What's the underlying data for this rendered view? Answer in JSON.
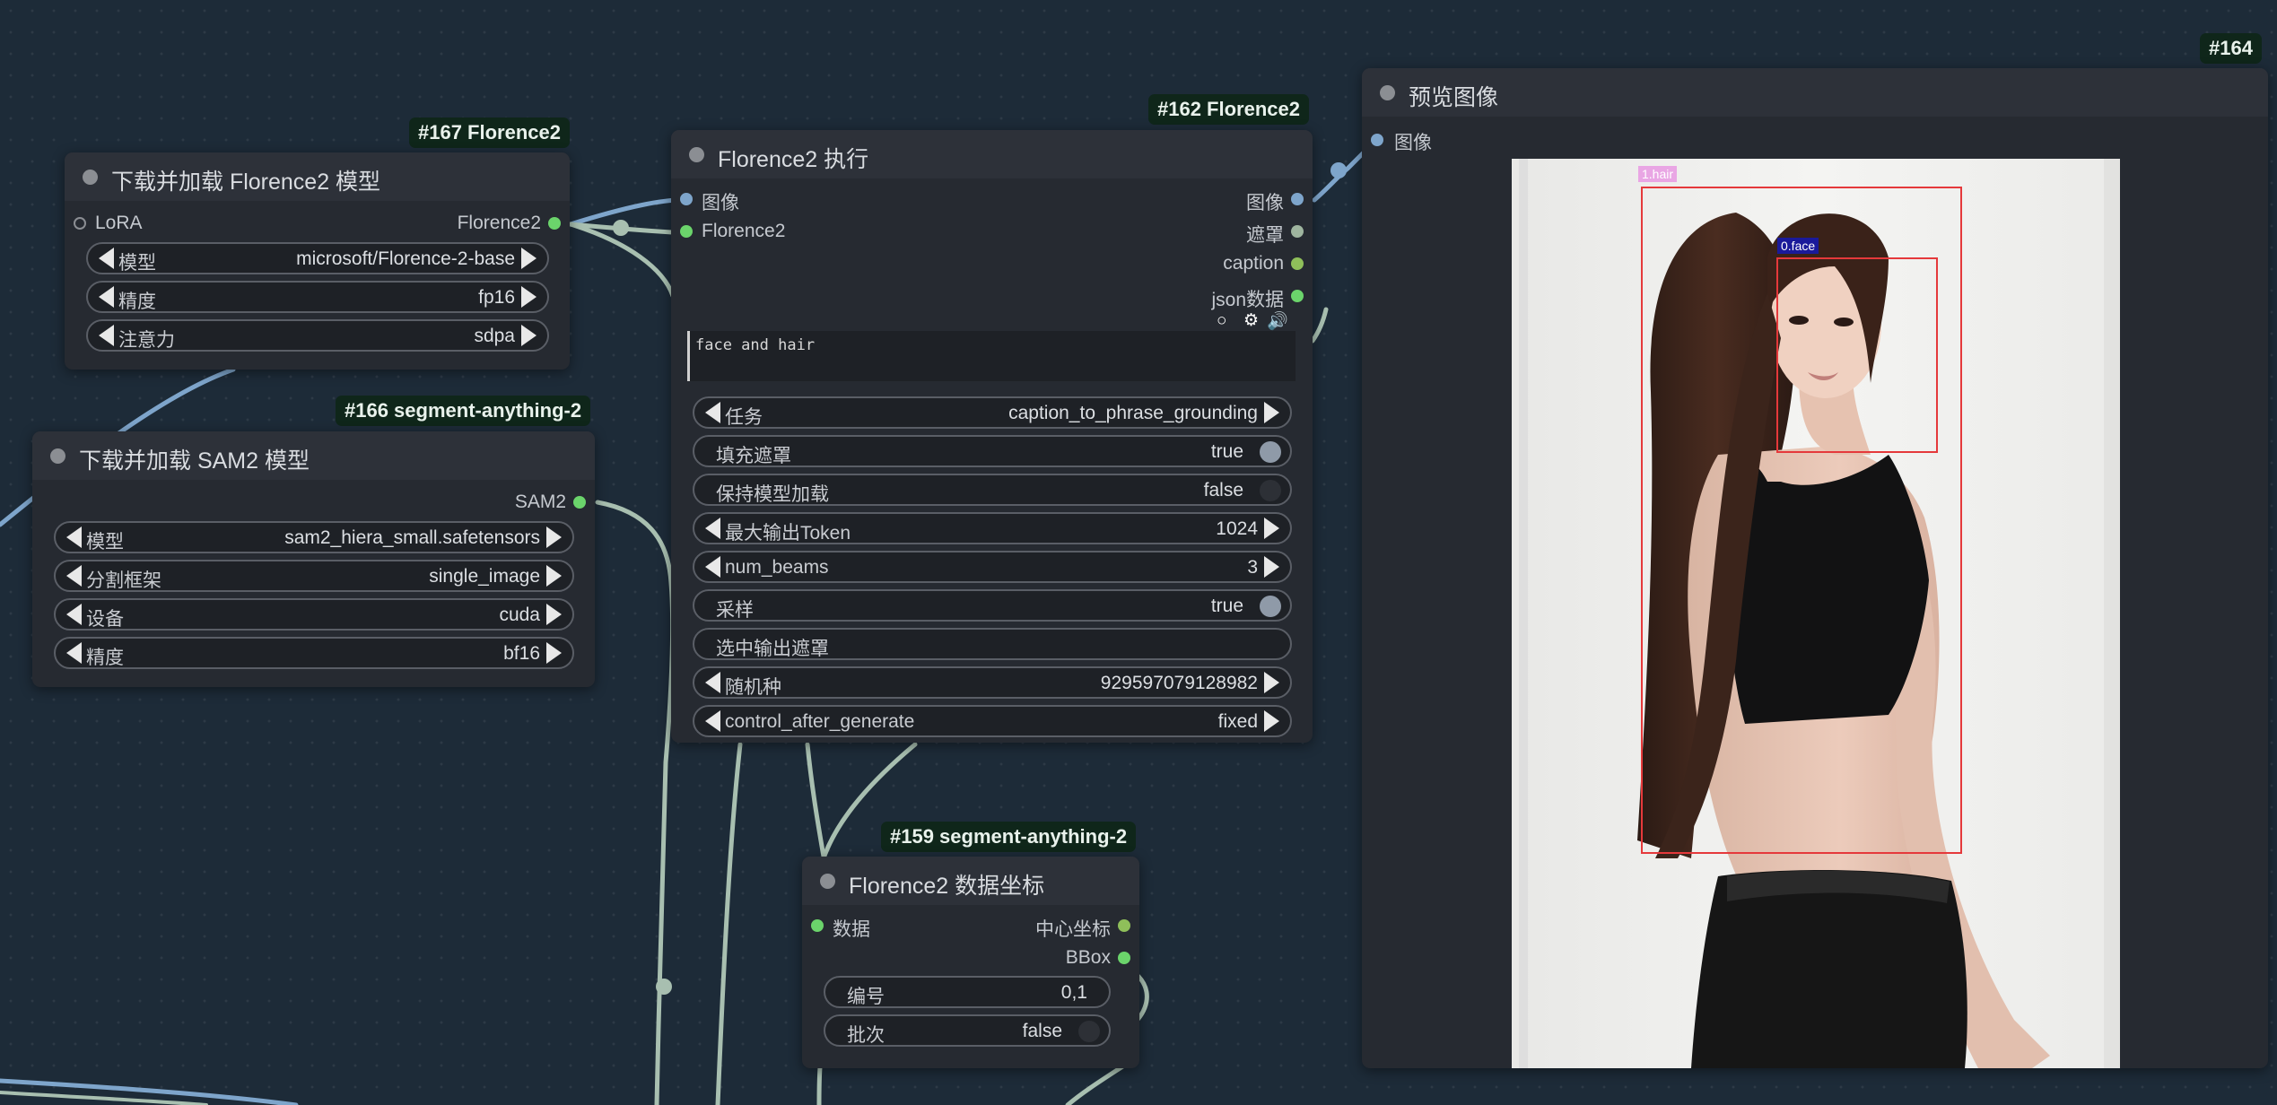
{
  "canvas": {
    "background": "#1d2b38",
    "wire_color": "#a8bfb0",
    "image_wire_color": "#7ea5cb"
  },
  "node_florence_loader": {
    "badge": "#167 Florence2",
    "title": "下载并加载 Florence2 模型",
    "input_lora": "LoRA",
    "output": "Florence2",
    "widgets": [
      {
        "label": "模型",
        "value": "microsoft/Florence-2-base"
      },
      {
        "label": "精度",
        "value": "fp16"
      },
      {
        "label": "注意力",
        "value": "sdpa"
      }
    ]
  },
  "node_sam2_loader": {
    "badge": "#166 segment-anything-2",
    "title": "下载并加载 SAM2 模型",
    "output": "SAM2",
    "widgets": [
      {
        "label": "模型",
        "value": "sam2_hiera_small.safetensors"
      },
      {
        "label": "分割框架",
        "value": "single_image"
      },
      {
        "label": "设备",
        "value": "cuda"
      },
      {
        "label": "精度",
        "value": "bf16"
      }
    ]
  },
  "node_florence_run": {
    "badge": "#162 Florence2",
    "title": "Florence2 执行",
    "inputs": [
      "图像",
      "Florence2"
    ],
    "outputs": [
      "图像",
      "遮罩",
      "caption",
      "json数据"
    ],
    "text_prompt": "face and hair",
    "widgets": {
      "task": {
        "label": "任务",
        "value": "caption_to_phrase_grounding"
      },
      "fill_mask": {
        "label": "填充遮罩",
        "value": "true"
      },
      "keep_loaded": {
        "label": "保持模型加载",
        "value": "false"
      },
      "max_tokens": {
        "label": "最大输出Token",
        "value": "1024"
      },
      "num_beams": {
        "label": "num_beams",
        "value": "3"
      },
      "do_sample": {
        "label": "采样",
        "value": "true"
      },
      "output_mask_select": {
        "label": "选中输出遮罩",
        "value": ""
      },
      "seed": {
        "label": "随机种",
        "value": "929597079128982"
      },
      "control": {
        "label": "control_after_generate",
        "value": "fixed"
      }
    }
  },
  "node_coords": {
    "badge": "#159 segment-anything-2",
    "title": "Florence2 数据坐标",
    "input": "数据",
    "outputs": [
      "中心坐标",
      "BBox"
    ],
    "widgets": [
      {
        "label": "编号",
        "value": "0,1"
      },
      {
        "label": "批次",
        "value": "false"
      }
    ]
  },
  "node_preview": {
    "badge": "#164",
    "title": "预览图像",
    "input": "图像",
    "detections": [
      {
        "label": "1.hair",
        "color": "#e04b4b",
        "label_bg": "#e9a6e4"
      },
      {
        "label": "0.face",
        "color": "#e04b4b",
        "label_bg": "#1a1a9a"
      }
    ]
  }
}
